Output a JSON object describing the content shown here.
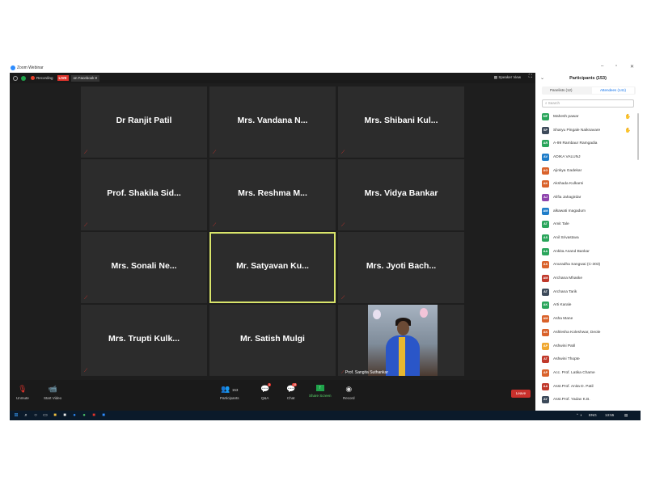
{
  "window": {
    "title": "Zoom Webinar",
    "minimize": "–",
    "maximize": "▫",
    "close": "✕"
  },
  "topbar": {
    "recording": "Recording",
    "live": "LIVE",
    "facebook": "on Facebook ▾",
    "speaker_view": "Speaker View"
  },
  "tiles": [
    {
      "name": "Dr Ranjit Patil"
    },
    {
      "name": "Mrs. Vandana N..."
    },
    {
      "name": "Mrs. Shibani Kul..."
    },
    {
      "name": "Prof. Shakila Sid..."
    },
    {
      "name": "Mrs. Reshma M..."
    },
    {
      "name": "Mrs. Vidya Bankar"
    },
    {
      "name": "Mrs. Sonali Ne..."
    },
    {
      "name": "Mr. Satyavan Ku..."
    },
    {
      "name": "Mrs. Jyoti Bach..."
    },
    {
      "name": "Mrs. Trupti Kulk..."
    },
    {
      "name": "Mr. Satish Mulgi"
    },
    {
      "name": "Prof. Sangita Suthankar"
    }
  ],
  "participants_panel": {
    "title": "Participants (153)",
    "tab_panelists": "Panelists (12)",
    "tab_attendees": "Attendees (141)",
    "search_placeholder": "Search",
    "attendees": [
      {
        "initials": "MP",
        "name": "Mahesh pawar",
        "color": "#2aa55b",
        "hand": "✋"
      },
      {
        "initials": "SP",
        "name": "Sharyu Pingale Naiknavare",
        "color": "#3d4a5a",
        "hand": "✋"
      },
      {
        "initials": "AR",
        "name": "A-99 Rambaur Ramgadia",
        "color": "#2aa55b"
      },
      {
        "initials": "AV",
        "name": "ADIKA VALUNJ",
        "color": "#1f7dc9"
      },
      {
        "initials": "AG",
        "name": "Ajinkya Gadekar",
        "color": "#d9622b"
      },
      {
        "initials": "AK",
        "name": "Akshada Kulkarni",
        "color": "#d9622b"
      },
      {
        "initials": "AJ",
        "name": "Alifia Jahagirdar",
        "color": "#8e44ad"
      },
      {
        "initials": "AM",
        "name": "alkawati magadum",
        "color": "#1f7dc9"
      },
      {
        "initials": "AT",
        "name": "Amit Tale",
        "color": "#2aa55b"
      },
      {
        "initials": "AS",
        "name": "Anil Srivastava",
        "color": "#2aa55b"
      },
      {
        "initials": "AA",
        "name": "Ankita Anand Bankar",
        "color": "#2aa55b"
      },
      {
        "initials": "AS",
        "name": "Anuradha Sangwai (C-303)",
        "color": "#d9622b"
      },
      {
        "initials": "AM",
        "name": "Archana Mhaske",
        "color": "#c0392b"
      },
      {
        "initials": "AT",
        "name": "Archana Tarik",
        "color": "#3d4a5a"
      },
      {
        "initials": "AK",
        "name": "Arti Karale",
        "color": "#2aa55b"
      },
      {
        "initials": "AM",
        "name": "Asha Mane",
        "color": "#d9622b"
      },
      {
        "initials": "AK",
        "name": "Ashlesha Koleshwar, Deole",
        "color": "#d9622b"
      },
      {
        "initials": "AP",
        "name": "Ashwini Patil",
        "color": "#f0a830"
      },
      {
        "initials": "AT",
        "name": "Ashwini Thopte",
        "color": "#c0392b"
      },
      {
        "initials": "AP",
        "name": "Acc. Prof. Latika Chame",
        "color": "#d9622b"
      },
      {
        "initials": "AA",
        "name": "Asst.Prof. Anita D. Patil",
        "color": "#c0392b"
      },
      {
        "initials": "AY",
        "name": "Asst.Prof. Yadav K.B.",
        "color": "#3d4a5a"
      }
    ]
  },
  "bottombar": {
    "unmute": "Unmute",
    "start_video": "Start Video",
    "participants": "Participants",
    "participants_count": "153",
    "qa": "Q&A",
    "qa_badge": "1",
    "chat": "Chat",
    "chat_badge": "18",
    "share_screen": "Share Screen",
    "record": "Record",
    "leave": "Leave"
  },
  "taskbar": {
    "lang": "ENG",
    "time": "13:55"
  }
}
